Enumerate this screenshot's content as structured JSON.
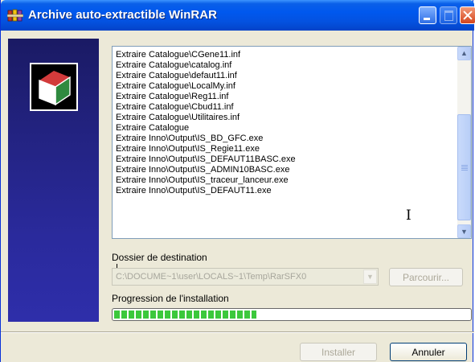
{
  "window": {
    "title": "Archive auto-extractible WinRAR",
    "icons": {
      "title_icon": "winrar-books-icon",
      "minimize": "minimize-icon",
      "maximize": "maximize-icon",
      "close": "close-icon"
    }
  },
  "log": {
    "lines": [
      "Extraire Catalogue\\CGene11.inf",
      "Extraire Catalogue\\catalog.inf",
      "Extraire Catalogue\\defaut11.inf",
      "Extraire Catalogue\\LocalMy.inf",
      "Extraire Catalogue\\Reg11.inf",
      "Extraire Catalogue\\Cbud11.inf",
      "Extraire Catalogue\\Utilitaires.inf",
      "Extraire Catalogue",
      "Extraire Inno\\Output\\IS_BD_GFC.exe",
      "Extraire Inno\\Output\\IS_Regie11.exe",
      "Extraire Inno\\Output\\IS_DEFAUT11BASC.exe",
      "Extraire Inno\\Output\\IS_ADMIN10BASC.exe",
      "Extraire Inno\\Output\\IS_traceur_lanceur.exe",
      "Extraire Inno\\Output\\IS_DEFAUT11.exe"
    ]
  },
  "destination": {
    "label": "Dossier de destination",
    "value": "C:\\DOCUME~1\\user\\LOCALS~1\\Temp\\RarSFX0",
    "browse_label": "Parcourir..."
  },
  "progress": {
    "label": "Progression de l'installation",
    "fraction": 0.4
  },
  "buttons": {
    "install_label": "Installer",
    "cancel_label": "Annuler"
  },
  "colors": {
    "titlebar": "#0058ee",
    "sidebar": "#232382",
    "progress_fill": "#3cc83c",
    "window_bg": "#ece9d8"
  }
}
